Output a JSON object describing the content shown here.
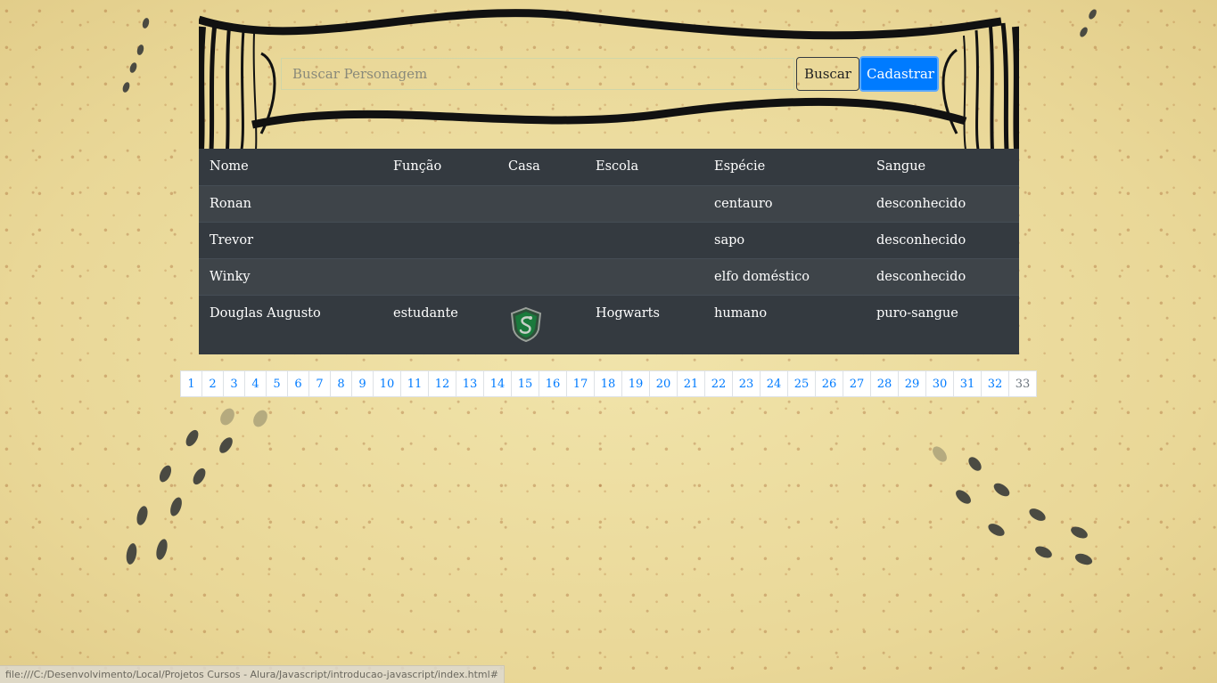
{
  "search": {
    "placeholder": "Buscar Personagem",
    "search_label": "Buscar",
    "register_label": "Cadastrar"
  },
  "table": {
    "headers": [
      "Nome",
      "Função",
      "Casa",
      "Escola",
      "Espécie",
      "Sangue"
    ],
    "rows": [
      {
        "nome": "Ronan",
        "funcao": "",
        "casa": "",
        "escola": "",
        "especie": "centauro",
        "sangue": "desconhecido"
      },
      {
        "nome": "Trevor",
        "funcao": "",
        "casa": "",
        "escola": "",
        "especie": "sapo",
        "sangue": "desconhecido"
      },
      {
        "nome": "Winky",
        "funcao": "",
        "casa": "",
        "escola": "",
        "especie": "elfo doméstico",
        "sangue": "desconhecido"
      },
      {
        "nome": "Douglas Augusto",
        "funcao": "estudante",
        "casa": "slytherin-crest-icon",
        "escola": "Hogwarts",
        "especie": "humano",
        "sangue": "puro-sangue"
      }
    ]
  },
  "pagination": {
    "pages": [
      "1",
      "2",
      "3",
      "4",
      "5",
      "6",
      "7",
      "8",
      "9",
      "10",
      "11",
      "12",
      "13",
      "14",
      "15",
      "16",
      "17",
      "18",
      "19",
      "20",
      "21",
      "22",
      "23",
      "24",
      "25",
      "26",
      "27",
      "28",
      "29",
      "30",
      "31",
      "32",
      "33"
    ],
    "active_color": "#007bff"
  },
  "status_bar": {
    "url": "file:///C:/Desenvolvimento/Local/Projetos Cursos - Alura/Javascript/introducao-javascript/index.html#"
  },
  "colors": {
    "table_bg": "#343a40",
    "primary": "#007bff",
    "parchment": "#efe1a6"
  }
}
